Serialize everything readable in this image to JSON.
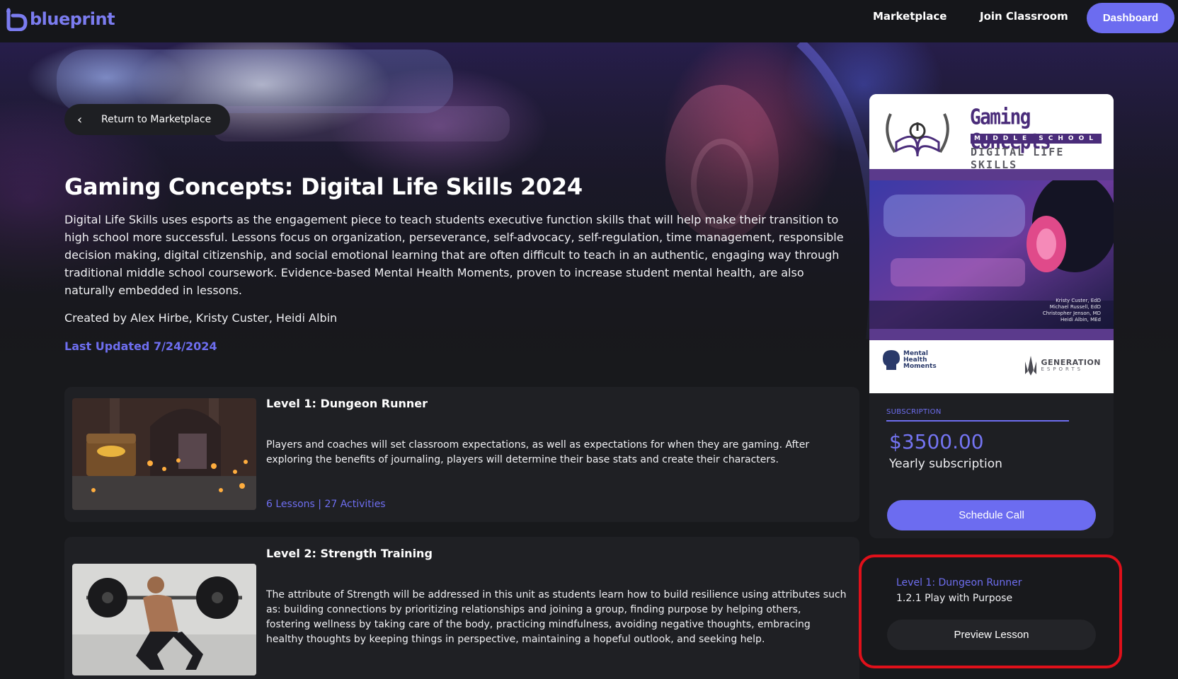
{
  "brand": {
    "name": "blueprint",
    "color": "#7b7cf0"
  },
  "nav": {
    "marketplace": "Marketplace",
    "join_classroom": "Join Classroom",
    "dashboard": "Dashboard"
  },
  "hero": {
    "back_label": "Return to Marketplace",
    "title": "Gaming Concepts: Digital Life Skills 2024",
    "description": "Digital Life Skills uses esports as the engagement piece to teach students executive function skills that will help make their transition to high school more successful. Lessons focus on organization, perseverance, self-advocacy, self-regulation, time management, responsible decision making, digital citizenship, and social emotional learning that are often difficult to teach in an authentic, engaging way through traditional middle school coursework. Evidence-based Mental Health Moments, proven to increase student mental health, are also naturally embedded in lessons.",
    "created_by": "Created by Alex Hirbe, Kristy Custer, Heidi Albin",
    "last_updated": "Last Updated 7/24/2024"
  },
  "levels": [
    {
      "title": "Level 1: Dungeon Runner",
      "body": "Players and coaches will set classroom expectations, as well as expectations for when they are gaming. After exploring the benefits of journaling, players will determine their base stats and create their characters.",
      "meta": "6 Lessons | 27 Activities"
    },
    {
      "title": "Level 2: Strength Training",
      "body": "The attribute of Strength will be addressed in this unit as students learn how to build resilience using attributes such as: building connections by prioritizing relationships and joining a group, finding purpose by helping others, fostering wellness by taking care of the body, practicing mindfulness, avoiding negative thoughts, embracing healthy thoughts by keeping things in perspective, maintaining a hopeful outlook, and seeking help."
    }
  ],
  "cover": {
    "title": "Gaming Concepts",
    "subtitle": "MIDDLE SCHOOL",
    "tagline": "DIGITAL LIFE SKILLS",
    "authors": [
      "Kristy Custer, EdD",
      "Michael Russell, EdD",
      "Christopher Jenson, MD",
      "Heidi Albin, MEd"
    ],
    "partner1": [
      "Mental",
      "Health",
      "Moments"
    ],
    "partner2": "GENERATION",
    "partner2_sub": "ESPORTS"
  },
  "subscription": {
    "label": "SUBSCRIPTION",
    "price": "$3500.00",
    "period": "Yearly subscription",
    "cta": "Schedule Call"
  },
  "preview": {
    "level": "Level 1: Dungeon Runner",
    "lesson": "1.2.1 Play with Purpose",
    "cta": "Preview Lesson"
  },
  "colors": {
    "accent": "#6c6cf0",
    "background": "#18191c",
    "card": "#1f2024",
    "highlight": "#e0101a",
    "cover_purple": "#4a2c7a"
  }
}
